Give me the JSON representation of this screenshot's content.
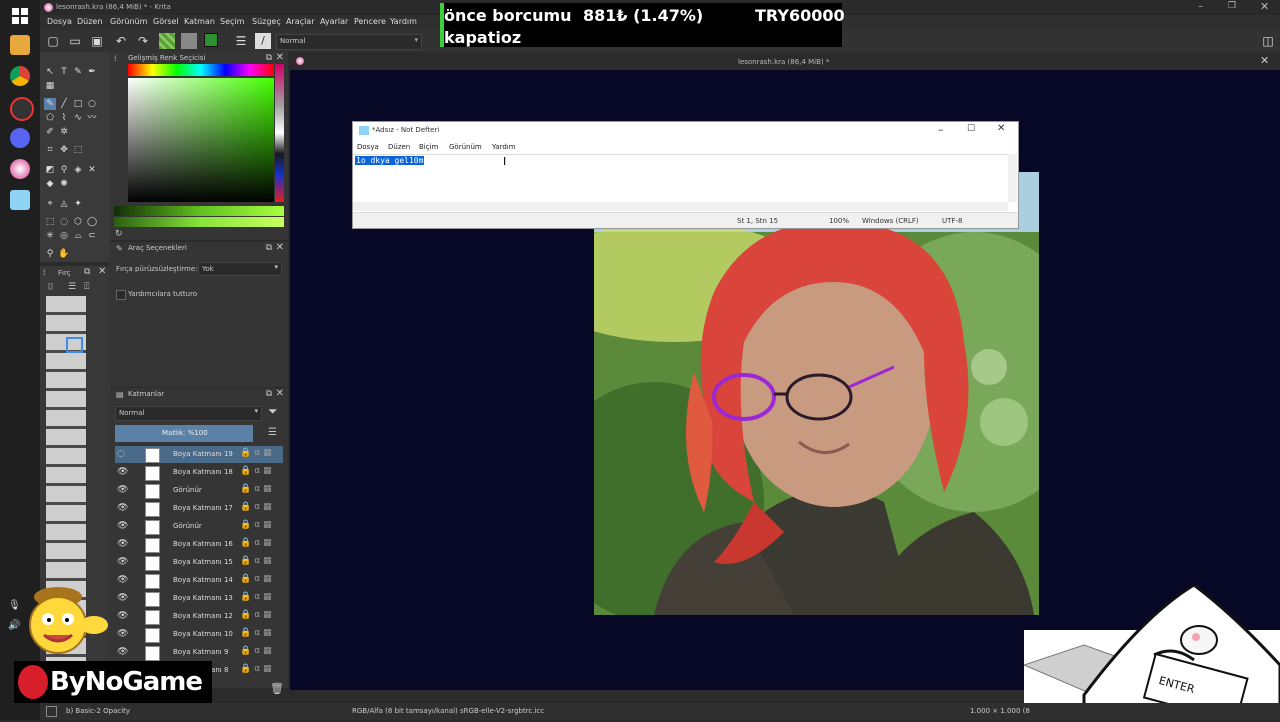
{
  "app": {
    "title": "lesonrash.kra (86,4 MiB) * - Krita",
    "doc_title": "lesonrash.kra (86,4 MiB) *"
  },
  "menu": [
    "Dosya",
    "Düzen",
    "Görünüm",
    "Görsel",
    "Katman",
    "Seçim",
    "Süzgeç",
    "Araçlar",
    "Ayarlar",
    "Pencere",
    "Yardım"
  ],
  "toolbar": {
    "blend_mode": "Normal"
  },
  "ticker": {
    "line1_label": "önce borcumu",
    "line1_value": "881₺ (1.47%)",
    "line1_target": "TRY60000",
    "line2": "kapatioz"
  },
  "color_panel": {
    "title": "Gelişmiş Renk Seçicisi"
  },
  "tool_options": {
    "title": "Araç Seçenekleri",
    "smoothing_label": "Fırça pürüzsüzleştirme:",
    "smoothing_value": "Yok",
    "snap_label": "Yardımcılara tutturo"
  },
  "brush_panel": {
    "title": "Fırç"
  },
  "layers": {
    "title": "Katmanlar",
    "blend": "Normal",
    "opacity": "Matlık: %100",
    "items": [
      {
        "name": "Boya Katmanı 19",
        "selected": true
      },
      {
        "name": "Boya Katmanı 18"
      },
      {
        "name": "Görünür"
      },
      {
        "name": "Boya Katmanı 17"
      },
      {
        "name": "Görünür"
      },
      {
        "name": "Boya Katmanı 16"
      },
      {
        "name": "Boya Katmanı 15"
      },
      {
        "name": "Boya Katmanı 14"
      },
      {
        "name": "Boya Katmanı 13"
      },
      {
        "name": "Boya Katmanı 12"
      },
      {
        "name": "Boya Katmanı 10"
      },
      {
        "name": "Boya Katmanı 9"
      },
      {
        "name": "Boya Katmanı 8"
      }
    ]
  },
  "notepad": {
    "title": "*Adsız - Not Defteri",
    "menu": [
      "Dosya",
      "Düzen",
      "Biçim",
      "Görünüm",
      "Yardım"
    ],
    "text": "1o dkya gel10m",
    "status_pos": "St 1, Stn 15",
    "status_zoom": "100%",
    "status_eol": "Windows (CRLF)",
    "status_enc": "UTF-8"
  },
  "status": {
    "brush": "b) Basic-2 Opacity",
    "color": "RGB/Alfa (8 bit tamsayı/kanal) sRGB-elle-V2-srgbtrc.icc",
    "size": "1.000 × 1.000 (8"
  },
  "watermark": "ByNoGame",
  "colors": {
    "accent": "#2f7bd6",
    "canvas_bg": "#070726"
  }
}
